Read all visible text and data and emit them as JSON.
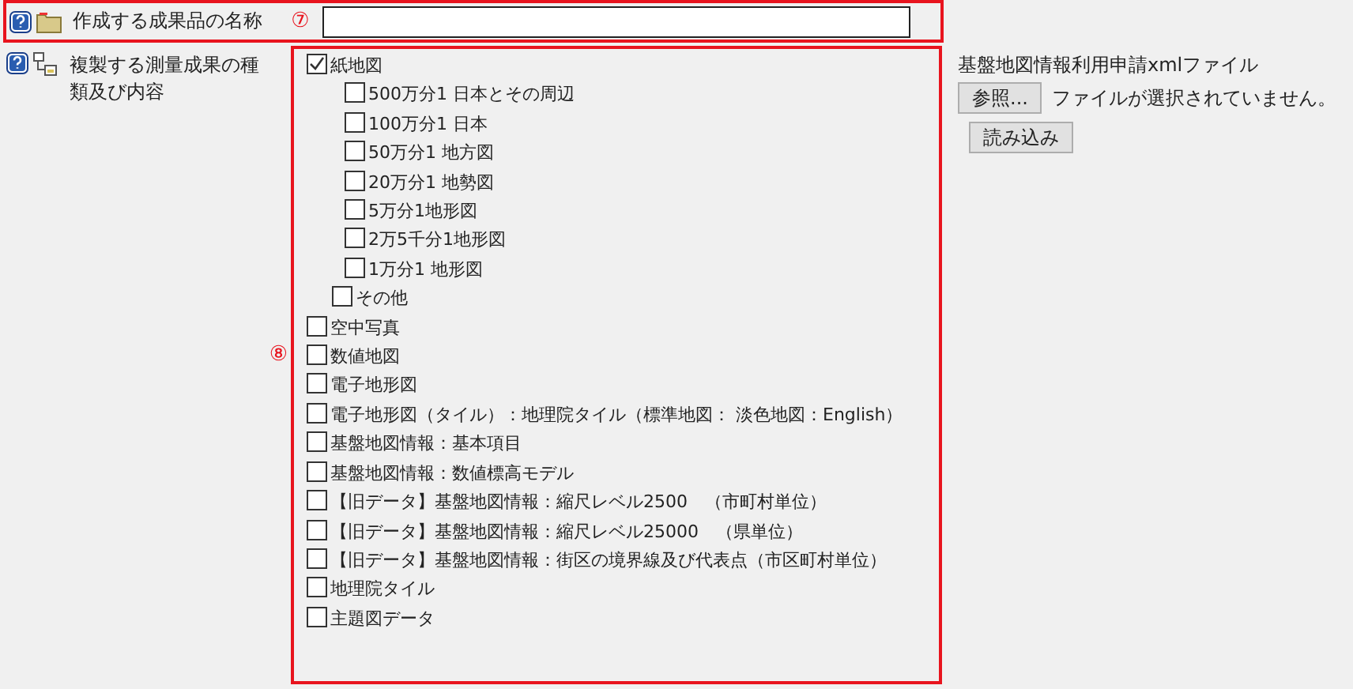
{
  "name_field": {
    "label": "作成する成果品の名称",
    "marker": "⑦"
  },
  "products": {
    "label": "複製する測量成果の種類及び内容",
    "marker": "⑧",
    "items": [
      {
        "label": "紙地図",
        "checked": true,
        "children": [
          {
            "kind": "scale",
            "label": "500万分1 日本とその周辺",
            "checked": false
          },
          {
            "kind": "scale",
            "label": "100万分1 日本",
            "checked": false
          },
          {
            "kind": "scale",
            "label": "50万分1 地方図",
            "checked": false
          },
          {
            "kind": "scale",
            "label": "20万分1 地勢図",
            "checked": false
          },
          {
            "kind": "scale",
            "label": "5万分1地形図",
            "checked": false
          },
          {
            "kind": "scale",
            "label": "2万5千分1地形図",
            "checked": false
          },
          {
            "kind": "scale",
            "label": "1万分1 地形図",
            "checked": false
          },
          {
            "kind": "other",
            "label": "その他",
            "checked": false
          }
        ]
      },
      {
        "label": "空中写真",
        "checked": false
      },
      {
        "label": "数値地図",
        "checked": false
      },
      {
        "label": "電子地形図",
        "checked": false
      },
      {
        "label": "電子地形図（タイル）：地理院タイル（標準地図： 淡色地図：English）",
        "checked": false
      },
      {
        "label": "基盤地図情報：基本項目",
        "checked": false
      },
      {
        "label": "基盤地図情報：数値標高モデル",
        "checked": false
      },
      {
        "label": "【旧データ】基盤地図情報：縮尺レベル2500　（市町村単位）",
        "checked": false
      },
      {
        "label": "【旧データ】基盤地図情報：縮尺レベル25000　（県単位）",
        "checked": false
      },
      {
        "label": "【旧データ】基盤地図情報：街区の境界線及び代表点（市区町村単位）",
        "checked": false
      },
      {
        "label": "地理院タイル",
        "checked": false
      },
      {
        "label": "主題図データ",
        "checked": false
      }
    ]
  },
  "xml_import": {
    "label": "基盤地図情報利用申請xmlファイル",
    "browse_button": "参照...",
    "file_status": "ファイルが選択されていません。",
    "load_button": "読み込み"
  }
}
